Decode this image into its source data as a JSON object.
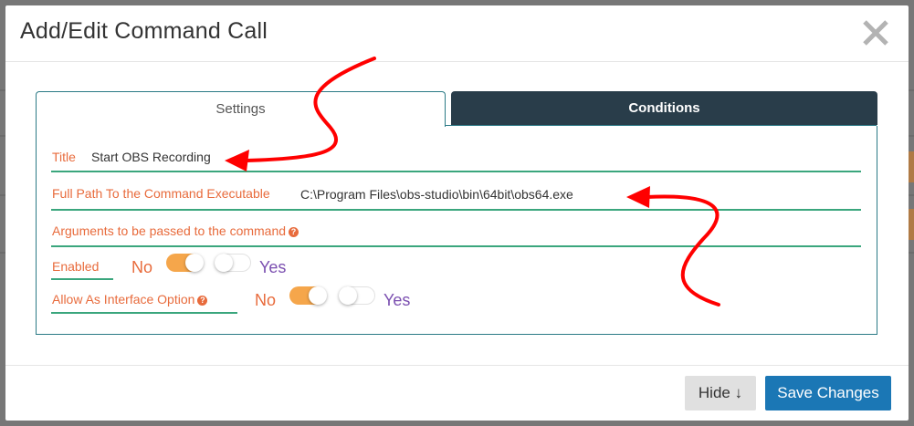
{
  "dialog": {
    "title": "Add/Edit Command Call"
  },
  "tabs": [
    {
      "label": "Settings",
      "active": true
    },
    {
      "label": "Conditions",
      "active": false
    }
  ],
  "form": {
    "title": {
      "label": "Title",
      "value": "Start OBS Recording"
    },
    "path": {
      "label": "Full Path To the Command Executable",
      "value": "C:\\Program Files\\obs-studio\\bin\\64bit\\obs64.exe"
    },
    "arguments": {
      "label": "Arguments to be passed to the command",
      "value": ""
    },
    "enabled": {
      "label": "Enabled",
      "no": "No",
      "yes": "Yes",
      "selected": "No"
    },
    "interface_option": {
      "label": "Allow As Interface Option",
      "no": "No",
      "yes": "Yes",
      "selected": "No"
    }
  },
  "footer": {
    "hide_label": "Hide ↓",
    "save_label": "Save Changes"
  },
  "colors": {
    "label": "#e86b3c",
    "underline": "#3aa67d",
    "tab_active_border": "#2b7a86",
    "tab_inactive_bg": "#293d4a",
    "primary_button": "#1b77b5",
    "yes_text": "#7b4fb0",
    "toggle_on": "#f5a64b",
    "annotation_arrow": "#ff0000"
  },
  "icons": {
    "close": "close-icon",
    "help": "help-icon"
  }
}
